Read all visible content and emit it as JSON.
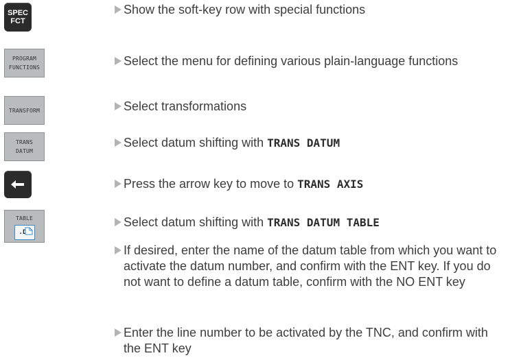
{
  "keys": {
    "spec_fct": [
      "SPEC",
      "FCT"
    ],
    "program_functions": [
      "PROGRAM",
      "FUNCTIONS"
    ],
    "transform": "TRANSFORM",
    "trans_datum": [
      "TRANS",
      "DATUM"
    ],
    "arrow_icon": "left-arrow-icon",
    "table": {
      "label": "TABLE",
      "file_ext": ".D",
      "icon": "table-file-icon"
    }
  },
  "steps": [
    {
      "text": "Show the soft-key row with special functions"
    },
    {
      "text": "Select the menu for defining various plain-language functions"
    },
    {
      "text": "Select transformations"
    },
    {
      "text": "Select datum shifting with ",
      "code": "TRANS DATUM"
    },
    {
      "text": "Press the arrow key to move to ",
      "code": "TRANS AXIS"
    },
    {
      "text": "Select datum shifting with ",
      "code": "TRANS DATUM TABLE"
    },
    {
      "text": "If desired, enter the name of the datum table from which you want to activate the datum number, and confirm with the ENT key. If you do not want to define a datum table, confirm with the NO ENT key"
    },
    {
      "text": "Enter the line number to be activated by the TNC, and confirm with the ENT key"
    }
  ],
  "colors": {
    "bullet": "#b3b3b3",
    "soft_key_bg": "#b8bcbd",
    "hardware_key_bg": "#2b2b2b",
    "icon_border": "#3c8bc8"
  }
}
